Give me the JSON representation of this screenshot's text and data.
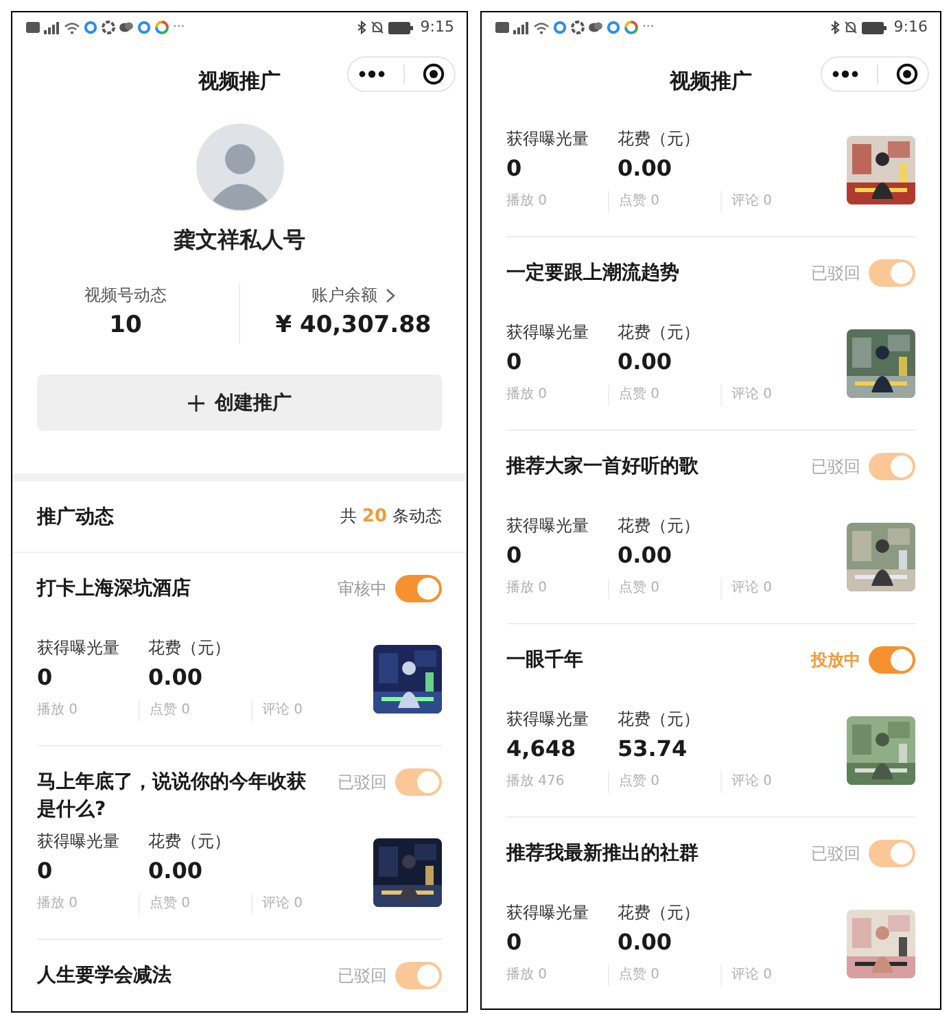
{
  "screens": [
    {
      "status_bar": {
        "more": "···",
        "time": "9:15"
      },
      "nav": {
        "title": "视频推广"
      },
      "profile": {
        "name": "龚文祥私人号",
        "stats": [
          {
            "label": "视频号动态",
            "value": "10",
            "link": false
          },
          {
            "label": "账户余额",
            "value": "¥ 40,307.88",
            "link": true
          }
        ]
      },
      "create_button": "创建推广",
      "feed_header": {
        "title": "推广动态",
        "prefix": "共",
        "count": "20",
        "suffix": "条动态"
      },
      "posts": [
        {
          "title": "打卡上海深坑酒店",
          "status": "审核中",
          "kind": "reviewing",
          "toggle": {
            "on": true,
            "disabled": false
          },
          "metrics": [
            {
              "label": "获得曝光量",
              "value": "0"
            },
            {
              "label": "花费（元）",
              "value": "0.00"
            }
          ],
          "counts": [
            "播放 0",
            "点赞 0",
            "评论 0"
          ]
        },
        {
          "title": "马上年底了，说说你的今年收获是什么?",
          "status": "已驳回",
          "kind": "rejected",
          "toggle": {
            "on": true,
            "disabled": true
          },
          "metrics": [
            {
              "label": "获得曝光量",
              "value": "0"
            },
            {
              "label": "花费（元）",
              "value": "0.00"
            }
          ],
          "counts": [
            "播放 0",
            "点赞 0",
            "评论 0"
          ]
        },
        {
          "title": "人生要学会减法",
          "status": "已驳回",
          "kind": "rejected",
          "toggle": {
            "on": true,
            "disabled": true
          }
        }
      ]
    },
    {
      "status_bar": {
        "more": "···",
        "time": "9:16"
      },
      "nav": {
        "title": "视频推广"
      },
      "posts": [
        {
          "metrics": [
            {
              "label": "获得曝光量",
              "value": "0"
            },
            {
              "label": "花费（元）",
              "value": "0.00"
            }
          ],
          "counts": [
            "播放 0",
            "点赞 0",
            "评论 0"
          ]
        },
        {
          "title": "一定要跟上潮流趋势",
          "status": "已驳回",
          "kind": "rejected",
          "toggle": {
            "on": true,
            "disabled": true
          },
          "metrics": [
            {
              "label": "获得曝光量",
              "value": "0"
            },
            {
              "label": "花费（元）",
              "value": "0.00"
            }
          ],
          "counts": [
            "播放 0",
            "点赞 0",
            "评论 0"
          ]
        },
        {
          "title": "推荐大家一首好听的歌",
          "status": "已驳回",
          "kind": "rejected",
          "toggle": {
            "on": true,
            "disabled": true
          },
          "metrics": [
            {
              "label": "获得曝光量",
              "value": "0"
            },
            {
              "label": "花费（元）",
              "value": "0.00"
            }
          ],
          "counts": [
            "播放 0",
            "点赞 0",
            "评论 0"
          ]
        },
        {
          "title": "一眼千年",
          "status": "投放中",
          "kind": "running",
          "toggle": {
            "on": true,
            "disabled": false
          },
          "metrics": [
            {
              "label": "获得曝光量",
              "value": "4,648"
            },
            {
              "label": "花费（元）",
              "value": "53.74"
            }
          ],
          "counts": [
            "播放 476",
            "点赞 0",
            "评论 0"
          ]
        },
        {
          "title": "推荐我最新推出的社群",
          "status": "已驳回",
          "kind": "rejected",
          "toggle": {
            "on": true,
            "disabled": true
          },
          "metrics": [
            {
              "label": "获得曝光量",
              "value": "0"
            },
            {
              "label": "花费（元）",
              "value": "0.00"
            }
          ],
          "counts": [
            "播放 0",
            "点赞 0",
            "评论 0"
          ]
        }
      ]
    }
  ]
}
